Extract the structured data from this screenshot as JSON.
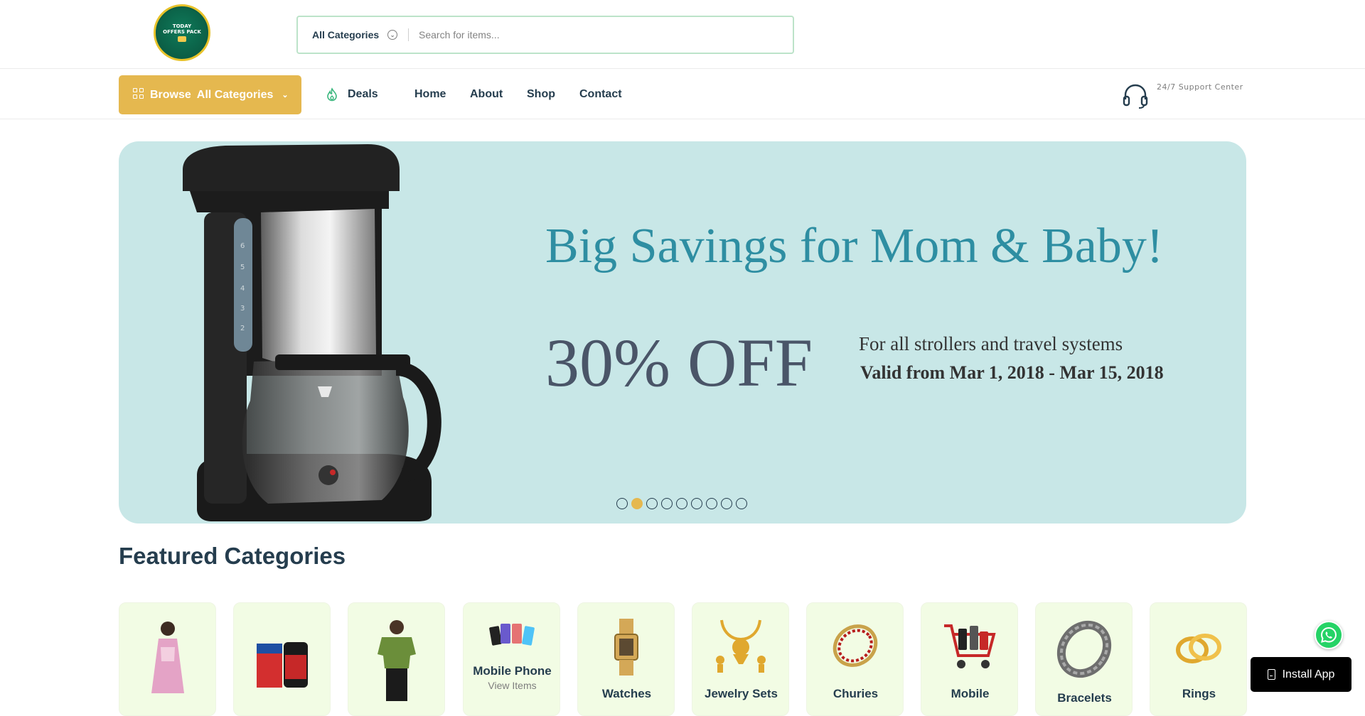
{
  "logo": {
    "line1": "TODAY",
    "line2": "OFFERS PACK"
  },
  "search": {
    "category_label": "All Categories",
    "placeholder": "Search for items..."
  },
  "nav": {
    "browse_label": "Browse",
    "browse_categories": "All Categories",
    "deals_label": "Deals",
    "links": [
      "Home",
      "About",
      "Shop",
      "Contact"
    ],
    "support_text": "24/7 Support Center"
  },
  "hero": {
    "title": "Big Savings for Mom & Baby!",
    "discount": "30% OFF",
    "subtitle": "For all strollers and travel systems",
    "validity": "Valid from Mar 1, 2018 - Mar 15, 2018",
    "slide_count": 9,
    "active_slide": 2,
    "background": "#c8e7e7"
  },
  "featured": {
    "title": "Featured Categories",
    "categories": [
      {
        "name": "",
        "sub": "",
        "icon": "dress-icon"
      },
      {
        "name": "",
        "sub": "",
        "icon": "health-supplement-icon"
      },
      {
        "name": "",
        "sub": "",
        "icon": "tshirt-man-icon"
      },
      {
        "name": "Mobile Phone",
        "sub": "View Items",
        "icon": "mobile-phone-icon"
      },
      {
        "name": "Watches",
        "sub": "",
        "icon": "watch-icon"
      },
      {
        "name": "Jewelry Sets",
        "sub": "",
        "icon": "jewelry-set-icon"
      },
      {
        "name": "Churies",
        "sub": "",
        "icon": "bangles-icon"
      },
      {
        "name": "Mobile",
        "sub": "",
        "icon": "mobile-accessories-icon"
      },
      {
        "name": "Bracelets",
        "sub": "",
        "icon": "bracelet-icon"
      },
      {
        "name": "Rings",
        "sub": "",
        "icon": "rings-icon"
      }
    ]
  },
  "floating": {
    "install_label": "Install App"
  },
  "colors": {
    "accent": "#e5b84f",
    "heading": "#253d4e",
    "card_bg": "#f2fce4",
    "hero_title": "#2e8ea2"
  }
}
